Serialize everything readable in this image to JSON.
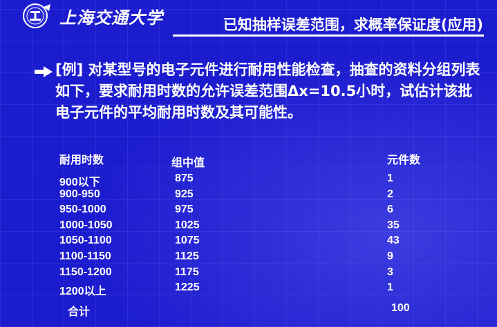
{
  "header": {
    "school_name": "上海交通大学",
    "slide_title": "已知抽样误差范围，求概率保证度(应用)"
  },
  "problem": {
    "bullet_icon": "arrow-right-icon",
    "text": "[例] 对某型号的电子元件进行耐用性能检查，抽查的资料分组列表如下，要求耐用时数的允许误差范围Δx=10.5小时，试估计该批电子元件的平均耐用时数及其可能性。"
  },
  "table": {
    "headers": [
      "耐用时数",
      "组中值",
      "元件数"
    ],
    "rows": [
      [
        "900以下",
        "875",
        "1"
      ],
      [
        "900-950",
        "925",
        "2"
      ],
      [
        "950-1000",
        "975",
        "6"
      ],
      [
        "1000-1050",
        "1025",
        "35"
      ],
      [
        "1050-1100",
        "1075",
        "43"
      ],
      [
        "1100-1150",
        "1125",
        "9"
      ],
      [
        "1150-1200",
        "1175",
        "3"
      ],
      [
        "1200以上",
        "1225",
        "1"
      ]
    ],
    "total_label": "合计",
    "total_value": "100"
  },
  "colors": {
    "background": "#1c1ccf",
    "text": "#ffffff"
  }
}
